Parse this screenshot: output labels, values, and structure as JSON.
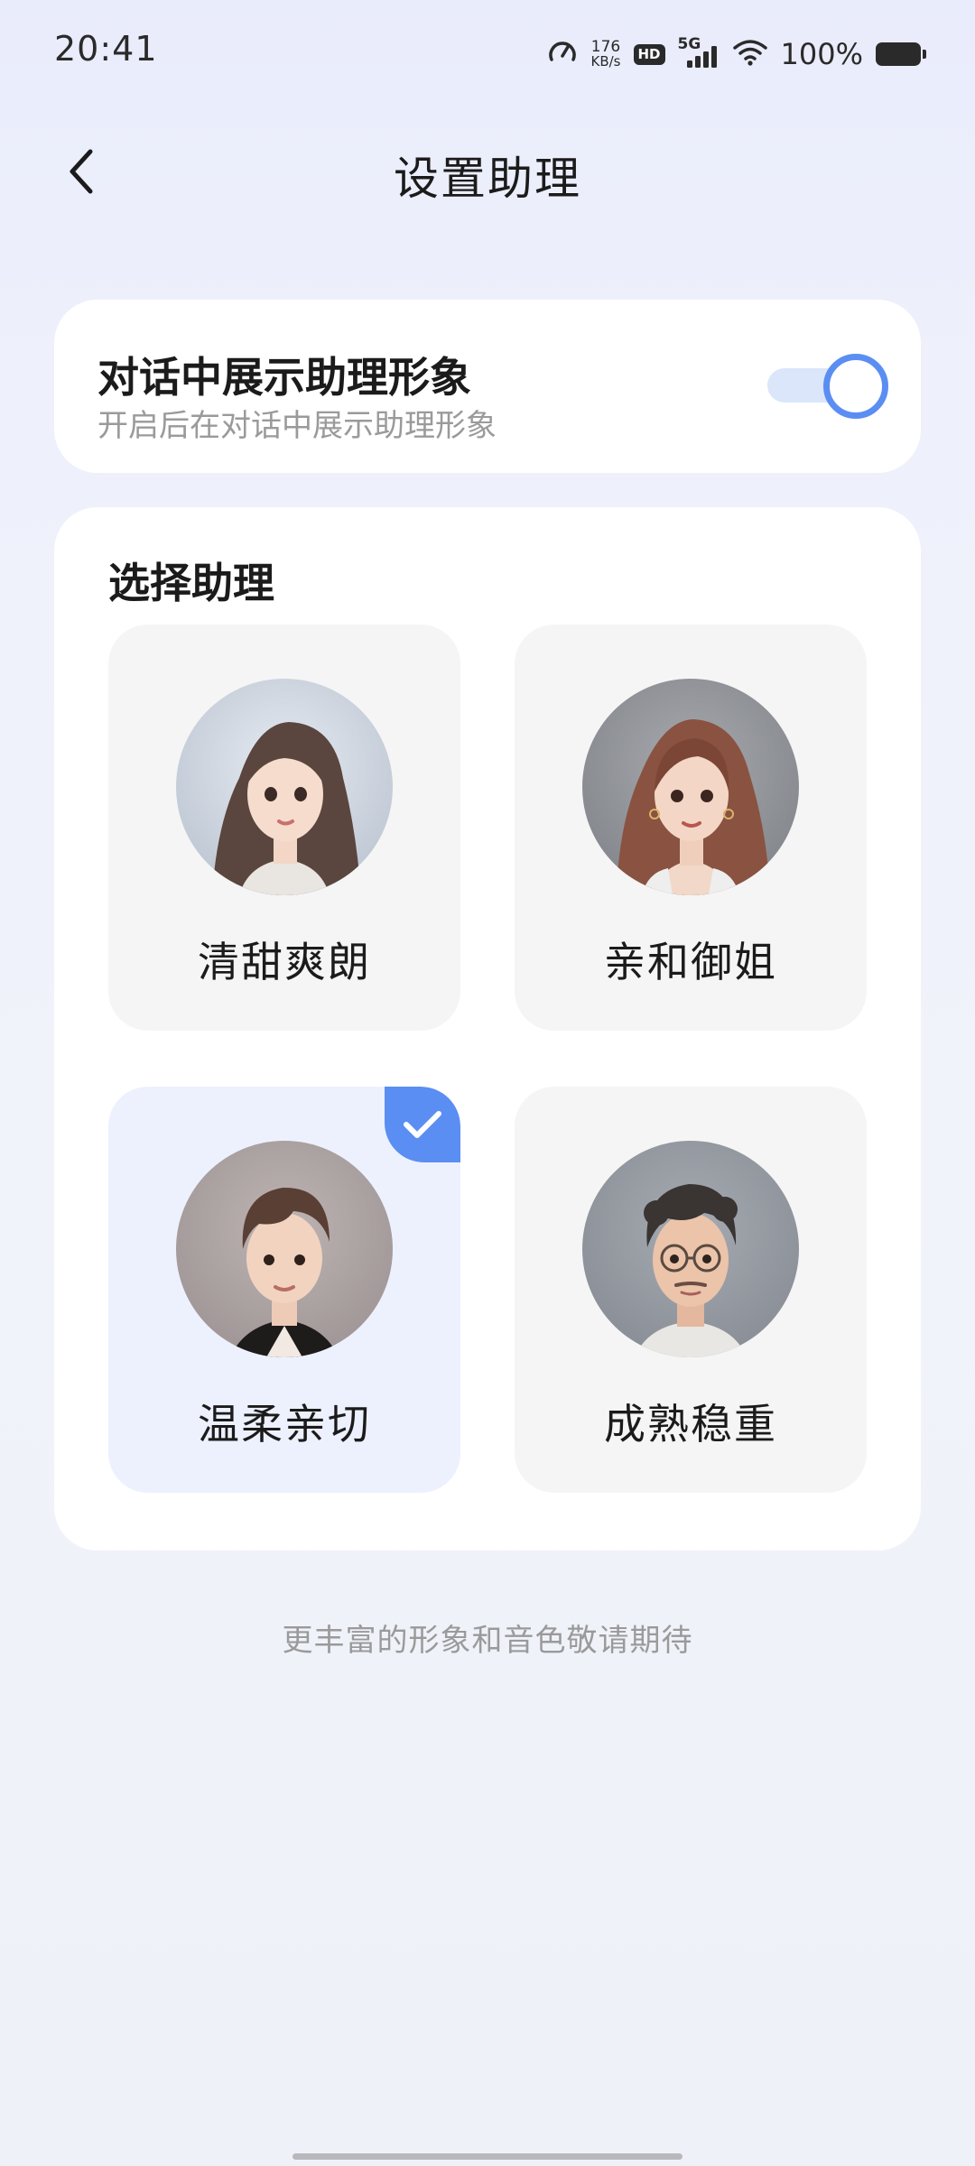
{
  "status_bar": {
    "time": "20:41",
    "net_speed_value": "176",
    "net_speed_unit": "KB/s",
    "hd_label": "HD",
    "network_type": "5G",
    "battery_percent": "100%",
    "icons": [
      "speedometer-icon",
      "hd-icon",
      "signal-5g-icon",
      "wifi-icon",
      "battery-icon"
    ]
  },
  "header": {
    "title": "设置助理",
    "back_icon": "chevron-left-icon"
  },
  "display_toggle": {
    "title": "对话中展示助理形象",
    "subtitle": "开启后在对话中展示助理形象",
    "enabled": true
  },
  "assistant_select": {
    "section_title": "选择助理",
    "selected_index": 2,
    "options": [
      {
        "label": "清甜爽朗",
        "avatar": "young-woman-long-hair-avatar"
      },
      {
        "label": "亲和御姐",
        "avatar": "woman-wavy-auburn-hair-avatar"
      },
      {
        "label": "温柔亲切",
        "avatar": "young-man-avatar"
      },
      {
        "label": "成熟稳重",
        "avatar": "man-glasses-curly-hair-avatar"
      }
    ]
  },
  "footer_note": "更丰富的形象和音色敬请期待",
  "colors": {
    "accent": "#5b8ef2",
    "toggle_track": "#dbe6fb",
    "selected_tile_bg": "#edf1fe",
    "tile_bg": "#f5f5f5",
    "secondary_text": "#9a9a9a"
  }
}
